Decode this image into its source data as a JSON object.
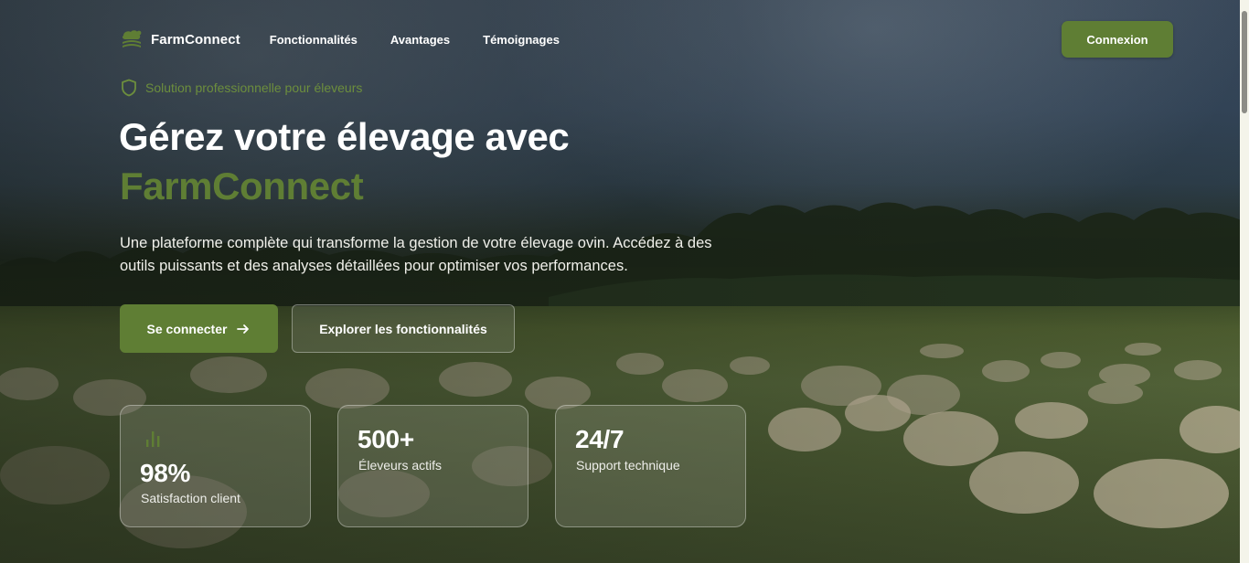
{
  "brand": {
    "name": "FarmConnect",
    "icon": "sheep-logo-icon"
  },
  "nav": {
    "links": [
      "Fonctionnalités",
      "Avantages",
      "Témoignages"
    ],
    "login_label": "Connexion"
  },
  "hero": {
    "badge_icon": "shield-icon",
    "badge_text": "Solution professionnelle pour éleveurs",
    "title_line1": "Gérez votre élevage avec",
    "title_line2": "FarmConnect",
    "description": "Une plateforme complète qui transforme la gestion de votre élevage ovin. Accédez à des outils puissants et des analyses détaillées pour optimiser vos performances.",
    "primary_cta": "Se connecter",
    "primary_cta_icon": "arrow-right-icon",
    "secondary_cta": "Explorer les fonctionnalités"
  },
  "stats": [
    {
      "icon": "bar-chart-icon",
      "value": "98%",
      "label": "Satisfaction client"
    },
    {
      "value": "500+",
      "label": "Éleveurs actifs"
    },
    {
      "value": "24/7",
      "label": "Support technique"
    }
  ],
  "colors": {
    "accent": "#5f7e34",
    "badge_text": "#6c8e3d",
    "text_primary": "#ffffff"
  }
}
